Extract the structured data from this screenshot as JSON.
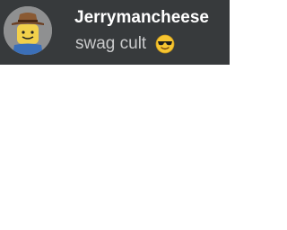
{
  "profile": {
    "username": "Jerrymancheese",
    "status_text": "swag cult",
    "status_emoji_icon": "sunglasses-emoji-icon",
    "avatar_icon": "roblox-avatar-icon"
  },
  "colors": {
    "header_bg": "#373a3c",
    "username": "#ffffff",
    "status": "#c9cacb",
    "page_bg": "#ffffff"
  }
}
